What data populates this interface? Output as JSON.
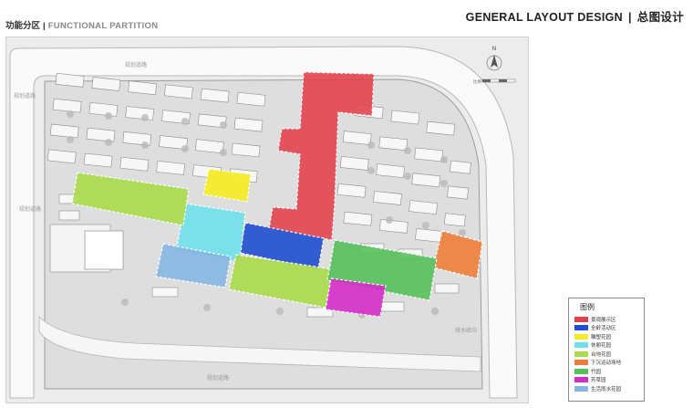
{
  "header": {
    "title_cn": "功能分区",
    "separator": "|",
    "title_en": "FUNCTIONAL PARTITION",
    "doc_title_en": "GENERAL LAYOUT DESIGN",
    "doc_title_cn": "总图设计"
  },
  "map": {
    "compass_label": "N",
    "scale_label": "比例",
    "road_labels": [
      "规划道路",
      "规划道路",
      "规划道路",
      "规划道路",
      "排水暗沟"
    ]
  },
  "legend": {
    "title": "图例",
    "items": [
      {
        "label": "景观展示区",
        "color": "#e2404a"
      },
      {
        "label": "全龄活动区",
        "color": "#1f4fd0"
      },
      {
        "label": "雕塑花园",
        "color": "#f4ec2a"
      },
      {
        "label": "休憩花园",
        "color": "#6fe0ea"
      },
      {
        "label": "台地花园",
        "color": "#a9dc4a"
      },
      {
        "label": "下沉运动场地",
        "color": "#ef7d3a"
      },
      {
        "label": "竹园",
        "color": "#57bf5c"
      },
      {
        "label": "芳草园",
        "color": "#d42ec8"
      },
      {
        "label": "生活雨水花园",
        "color": "#86b6e2"
      }
    ]
  }
}
